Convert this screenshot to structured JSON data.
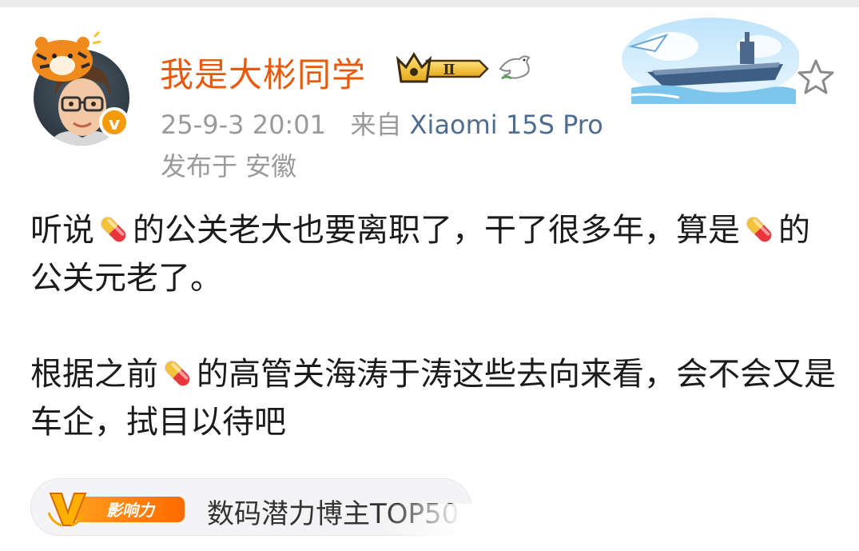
{
  "post": {
    "username": "我是大彬同学",
    "vip_level": "Ⅱ",
    "verified_mark": "v",
    "time": "25-9-3 20:01",
    "source_prefix": "来自",
    "source_device": "Xiaomi 15S Pro",
    "location": "发布于 安徽",
    "paragraphs": [
      [
        {
          "text": "听说"
        },
        {
          "emoji": "pill-emoji"
        },
        {
          "text": "的公关老大也要离职了，干了很多年，算是"
        },
        {
          "emoji": "pill-emoji"
        },
        {
          "text": "的公关元老了。"
        }
      ],
      [
        {
          "text": "根据之前"
        },
        {
          "emoji": "pill-emoji"
        },
        {
          "text": "的高管关海涛于涛这些去向来看，会不会又是车企，拭目以待吧"
        }
      ]
    ],
    "tag": {
      "badge_text": "影响力",
      "label": "数码潜力博主TOP50"
    }
  },
  "colors": {
    "username": "#e9590b",
    "meta": "#9a9a9a",
    "source_link": "#4f6d8f",
    "badge_orange": "#f59a0b"
  },
  "icons": [
    "avatar",
    "tiger-sticker",
    "verified-icon",
    "vip-crown-icon",
    "dove-icon",
    "aircraft-carrier-cover",
    "star-icon",
    "pill-emoji",
    "influence-badge-icon"
  ]
}
